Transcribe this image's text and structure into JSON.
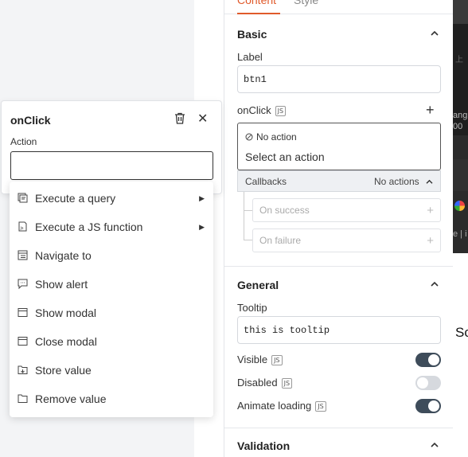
{
  "tabs": {
    "content": "Content",
    "style": "Style"
  },
  "basic": {
    "title": "Basic",
    "label_label": "Label",
    "label_value": "btn1",
    "onclick_label": "onClick",
    "js_badge": "JS",
    "no_action": "No action",
    "select_action": "Select an action",
    "callbacks_label": "Callbacks",
    "callbacks_value": "No actions",
    "on_success": "On success",
    "on_failure": "On failure"
  },
  "general": {
    "title": "General",
    "tooltip_label": "Tooltip",
    "tooltip_value": "this is tooltip",
    "visible_label": "Visible",
    "visible_on": true,
    "disabled_label": "Disabled",
    "disabled_on": false,
    "animate_label": "Animate loading",
    "animate_on": true
  },
  "validation": {
    "title": "Validation"
  },
  "popup": {
    "title": "onClick",
    "action_label": "Action",
    "close_glyph": "✕",
    "items": [
      {
        "label": "Execute a query",
        "icon": "query-icon",
        "submenu": true
      },
      {
        "label": "Execute a JS function",
        "icon": "js-function-icon",
        "submenu": true
      },
      {
        "label": "Navigate to",
        "icon": "navigate-icon",
        "submenu": false
      },
      {
        "label": "Show alert",
        "icon": "alert-icon",
        "submenu": false
      },
      {
        "label": "Show modal",
        "icon": "modal-icon",
        "submenu": false
      },
      {
        "label": "Close modal",
        "icon": "close-modal-icon",
        "submenu": false
      },
      {
        "label": "Store value",
        "icon": "store-value-icon",
        "submenu": false
      },
      {
        "label": "Remove value",
        "icon": "remove-value-icon",
        "submenu": false
      }
    ]
  },
  "app_strip": {
    "big_letters": "Sc",
    "top": "上",
    "mid": "ang\n00",
    "mid2": "e | i"
  },
  "colors": {
    "accent": "#e05a2b",
    "toggle_on": "#3e4c5a",
    "toggle_off": "#d6d9de"
  }
}
